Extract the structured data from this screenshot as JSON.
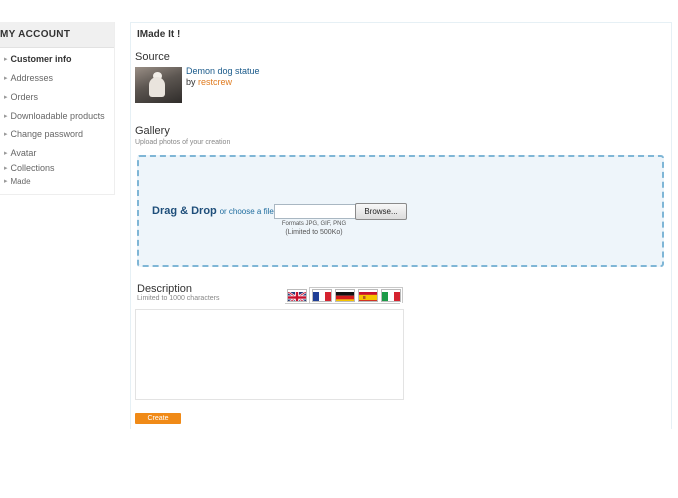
{
  "sidebar": {
    "title": "MY ACCOUNT",
    "items": [
      {
        "label": "Customer info",
        "active": true
      },
      {
        "label": "Addresses"
      },
      {
        "label": "Orders"
      },
      {
        "label": "Downloadable products"
      },
      {
        "label": "Change password"
      },
      {
        "label": "Avatar"
      },
      {
        "label": "Collections"
      },
      {
        "label": "Made"
      }
    ]
  },
  "main": {
    "page_title": "IMade It !",
    "source": {
      "heading": "Source",
      "item_title": "Demon dog statue",
      "by_label": "by",
      "by_user": "restcrew"
    },
    "gallery": {
      "heading": "Gallery",
      "subtitle": "Upload photos of your creation",
      "drag_drop_label": "Drag & Drop",
      "or_choose_label": "or choose a file:",
      "file_value": "",
      "browse_label": "Browse...",
      "formats_text": "Formats JPG, GIF, PNG",
      "limit_text": "(Limited to 500Ko)"
    },
    "description": {
      "heading": "Description",
      "subtitle": "Limited to 1000 characters",
      "value": "",
      "languages": [
        "en-flag-icon",
        "fr-flag-icon",
        "de-flag-icon",
        "es-flag-icon",
        "it-flag-icon"
      ]
    },
    "create_label": "Create"
  },
  "colors": {
    "accent_orange": "#f08a17",
    "link_blue": "#1a5a8a",
    "dropzone_border": "#7fb6d6",
    "dropzone_bg": "#eef5fa"
  }
}
